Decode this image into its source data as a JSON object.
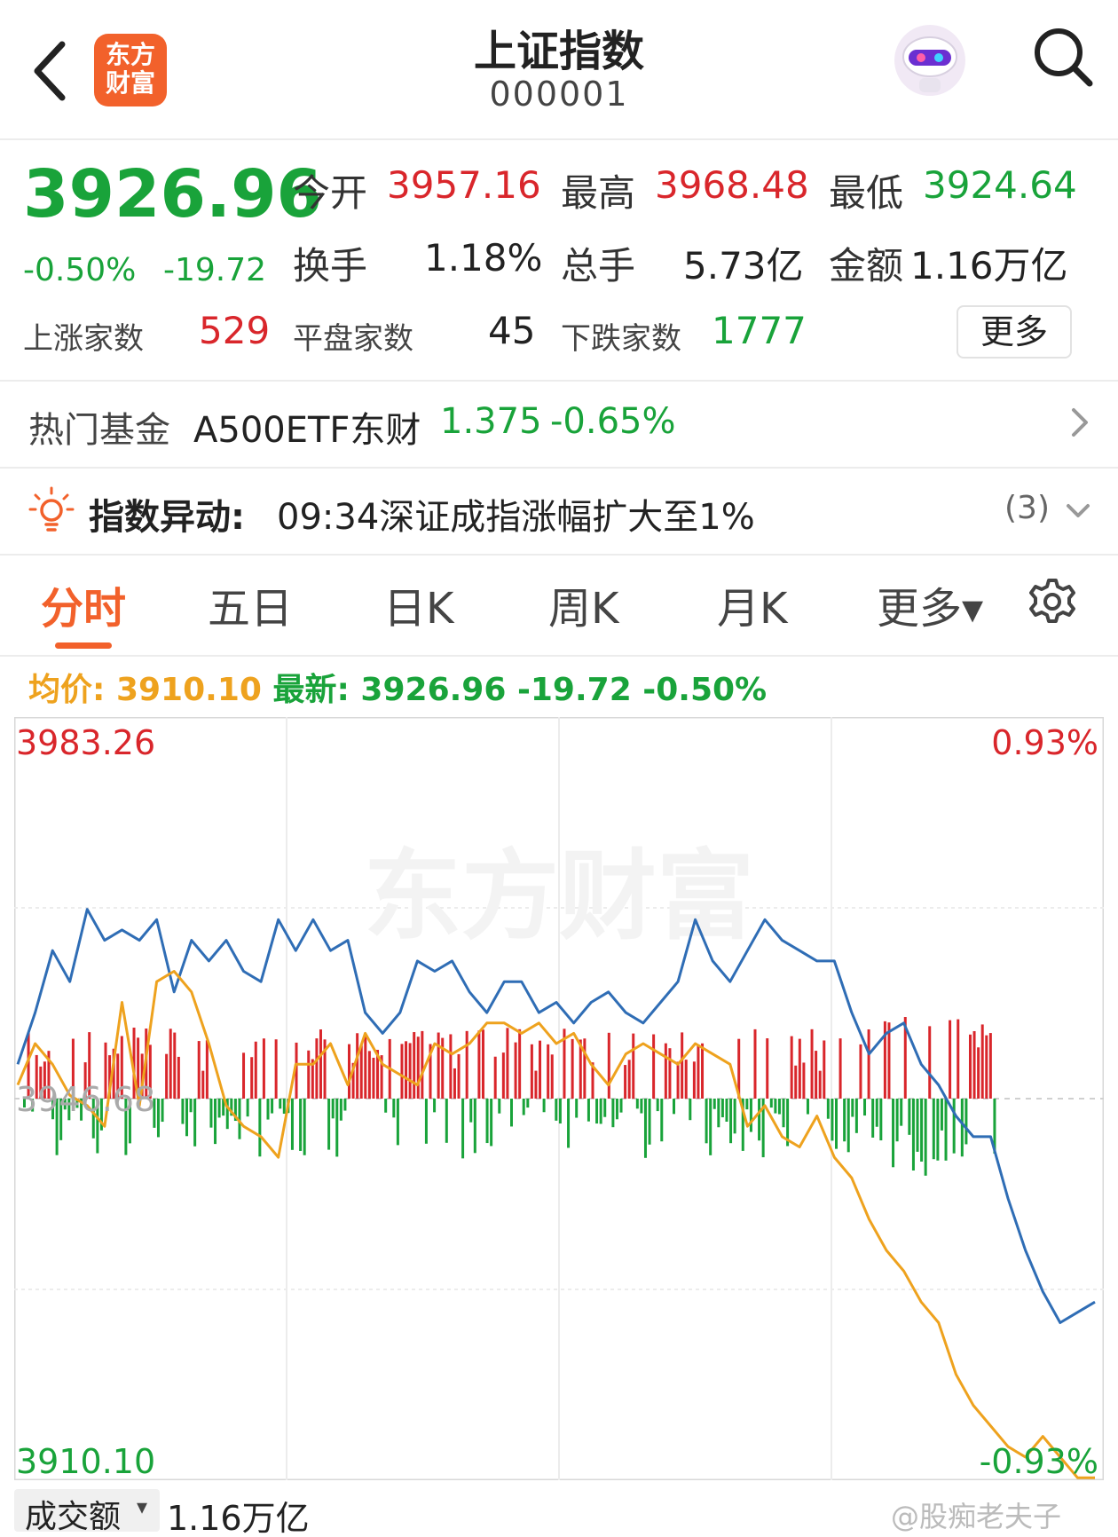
{
  "header": {
    "title": "上证指数",
    "code": "000001",
    "logo_line1": "东方",
    "logo_line2": "财富"
  },
  "quote": {
    "price": "3926.96",
    "change_pct": "-0.50%",
    "change_val": "-19.72",
    "open_label": "今开",
    "open_value": "3957.16",
    "high_label": "最高",
    "high_value": "3968.48",
    "low_label": "最低",
    "low_value": "3924.64",
    "turnover_label": "换手",
    "turnover_value": "1.18%",
    "volume_label": "总手",
    "volume_value": "5.73亿",
    "amount_label": "金额",
    "amount_value": "1.16万亿",
    "up_label": "上涨家数",
    "up_value": "529",
    "flat_label": "平盘家数",
    "flat_value": "45",
    "down_label": "下跌家数",
    "down_value": "1777",
    "more_label": "更多"
  },
  "fund_row": {
    "label": "热门基金",
    "name": "A500ETF东财",
    "price": "1.375",
    "change": "-0.65%"
  },
  "alert_row": {
    "label": "指数异动:",
    "text": "09:34深证成指涨幅扩大至1%",
    "count": "(3)"
  },
  "tabs": [
    "分时",
    "五日",
    "日K",
    "周K",
    "月K",
    "更多▾"
  ],
  "legend": {
    "avg_label": "均价:",
    "avg_value": "3910.10",
    "latest_label": "最新:",
    "latest_value": "3926.96",
    "latest_change": "-19.72",
    "latest_pct": "-0.50%"
  },
  "chart_data": {
    "type": "line",
    "y_left_top": "3983.26",
    "y_left_mid": "3946.68",
    "y_left_bottom": "3910.10",
    "y_right_top": "0.93%",
    "y_right_bottom": "-0.93%",
    "watermark": "东方财富",
    "ylim": [
      3910.1,
      3983.26
    ],
    "baseline": 3946.68,
    "series": [
      {
        "name": "最新",
        "color": "#2f6db5",
        "values": [
          3950,
          3955,
          3961,
          3958,
          3965,
          3962,
          3963,
          3962,
          3964,
          3957,
          3962,
          3960,
          3962,
          3959,
          3958,
          3964,
          3961,
          3964,
          3961,
          3962,
          3955,
          3953,
          3955,
          3960,
          3959,
          3960,
          3957,
          3955,
          3958,
          3958,
          3955,
          3956,
          3954,
          3956,
          3957,
          3955,
          3954,
          3956,
          3958,
          3964,
          3960,
          3958,
          3961,
          3964,
          3962,
          3961,
          3960,
          3960,
          3955,
          3951,
          3953,
          3954,
          3950,
          3948,
          3945,
          3943,
          3943,
          3937,
          3932,
          3928,
          3925,
          3926,
          3927
        ]
      },
      {
        "name": "均价",
        "color": "#eea21e",
        "values": [
          3948,
          3952,
          3950,
          3947,
          3946,
          3944,
          3956,
          3946,
          3958,
          3959,
          3957,
          3952,
          3946,
          3944,
          3943,
          3941,
          3950,
          3950,
          3952,
          3948,
          3953,
          3950,
          3949,
          3948,
          3952,
          3951,
          3952,
          3954,
          3954,
          3953,
          3954,
          3952,
          3953,
          3950,
          3948,
          3951,
          3952,
          3951,
          3950,
          3952,
          3951,
          3950,
          3944,
          3946,
          3943,
          3942,
          3945,
          3941,
          3939,
          3935,
          3932,
          3930,
          3927,
          3925,
          3920,
          3917,
          3915,
          3913,
          3912,
          3914,
          3912,
          3910,
          3910
        ]
      }
    ]
  },
  "volume": {
    "label": "成交额",
    "arrow": "▾",
    "value": "1.16万亿"
  },
  "watermark_credit": "@股痴老夫子",
  "colors": {
    "brand": "#f2612b",
    "up": "#d9262b",
    "down": "#19a33a",
    "avg": "#eea21e",
    "line": "#2f6db5"
  }
}
